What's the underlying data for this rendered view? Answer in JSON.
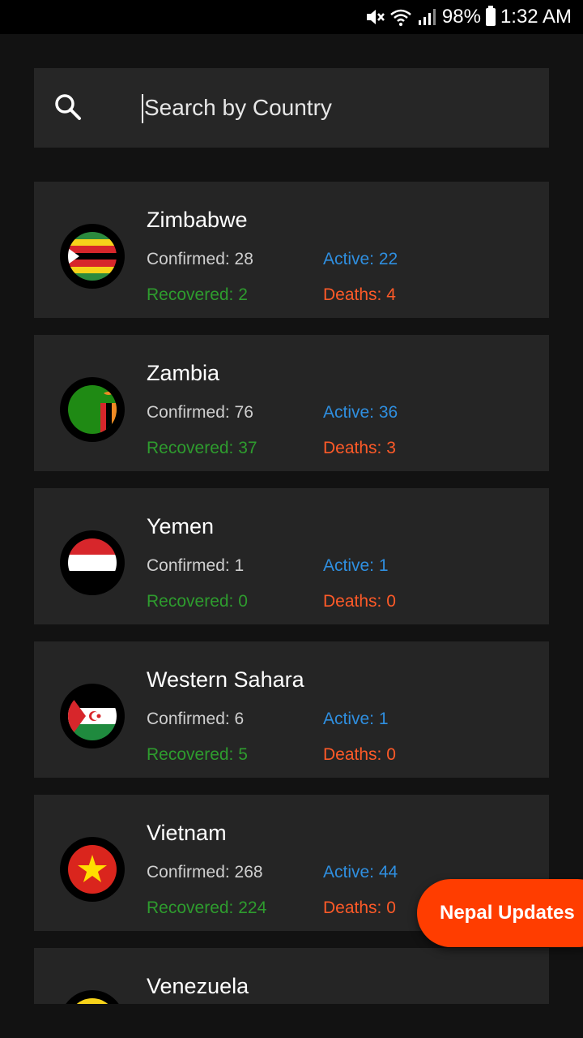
{
  "status_bar": {
    "battery": "98%",
    "time": "1:32 AM",
    "icons": [
      "mute-icon",
      "wifi-icon",
      "signal-icon",
      "battery-icon"
    ]
  },
  "search": {
    "placeholder": "Search by Country",
    "value": ""
  },
  "labels": {
    "confirmed": "Confirmed:",
    "active": "Active:",
    "recovered": "Recovered:",
    "deaths": "Deaths:"
  },
  "countries": [
    {
      "name": "Zimbabwe",
      "confirmed": "Confirmed: 28",
      "active": "Active: 22",
      "recovered": "Recovered: 2",
      "deaths": "Deaths: 4",
      "flag": "zimbabwe-flag-icon"
    },
    {
      "name": "Zambia",
      "confirmed": "Confirmed: 76",
      "active": "Active: 36",
      "recovered": "Recovered: 37",
      "deaths": "Deaths: 3",
      "flag": "zambia-flag-icon"
    },
    {
      "name": "Yemen",
      "confirmed": "Confirmed: 1",
      "active": "Active: 1",
      "recovered": "Recovered: 0",
      "deaths": "Deaths: 0",
      "flag": "yemen-flag-icon"
    },
    {
      "name": "Western Sahara",
      "confirmed": "Confirmed: 6",
      "active": "Active: 1",
      "recovered": "Recovered: 5",
      "deaths": "Deaths: 0",
      "flag": "western-sahara-flag-icon"
    },
    {
      "name": "Vietnam",
      "confirmed": "Confirmed: 268",
      "active": "Active: 44",
      "recovered": "Recovered: 224",
      "deaths": "Deaths: 0",
      "flag": "vietnam-flag-icon"
    },
    {
      "name": "Venezuela",
      "flag": "venezuela-flag-icon"
    }
  ],
  "fab": {
    "label": "Nepal Updates"
  },
  "colors": {
    "background": "#121212",
    "card": "#252525",
    "confirmed": "#cfcfcf",
    "active": "#2f8fe0",
    "recovered": "#2e9c2e",
    "deaths": "#ff5a28",
    "fab": "#ff3d00"
  }
}
